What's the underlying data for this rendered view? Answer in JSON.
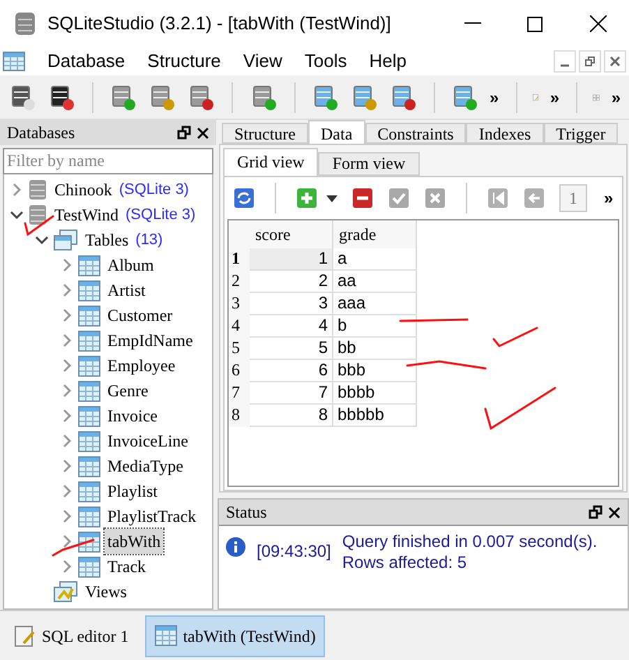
{
  "window": {
    "title": "SQLiteStudio (3.2.1) - [tabWith (TestWind)]"
  },
  "menu": [
    "Database",
    "Structure",
    "View",
    "Tools",
    "Help"
  ],
  "toolbar_overflow": [
    "»",
    "»",
    "»"
  ],
  "databases_panel": {
    "title": "Databases",
    "filter": {
      "placeholder": "Filter by name"
    },
    "tree": [
      {
        "label": "Chinook",
        "badge": "(SQLite 3)",
        "kind": "database",
        "expanded": false,
        "selected": false
      },
      {
        "label": "TestWind",
        "badge": "(SQLite 3)",
        "kind": "database",
        "expanded": true,
        "selected": false,
        "children": [
          {
            "label": "Tables",
            "badge": "(13)",
            "kind": "folder",
            "expanded": true,
            "selected": false,
            "children": [
              {
                "label": "Album",
                "kind": "table",
                "expanded": false,
                "selected": false
              },
              {
                "label": "Artist",
                "kind": "table",
                "expanded": false,
                "selected": false
              },
              {
                "label": "Customer",
                "kind": "table",
                "expanded": false,
                "selected": false
              },
              {
                "label": "EmpIdName",
                "kind": "table",
                "expanded": false,
                "selected": false
              },
              {
                "label": "Employee",
                "kind": "table",
                "expanded": false,
                "selected": false
              },
              {
                "label": "Genre",
                "kind": "table",
                "expanded": false,
                "selected": false
              },
              {
                "label": "Invoice",
                "kind": "table",
                "expanded": false,
                "selected": false
              },
              {
                "label": "InvoiceLine",
                "kind": "table",
                "expanded": false,
                "selected": false
              },
              {
                "label": "MediaType",
                "kind": "table",
                "expanded": false,
                "selected": false
              },
              {
                "label": "Playlist",
                "kind": "table",
                "expanded": false,
                "selected": false
              },
              {
                "label": "PlaylistTrack",
                "kind": "table",
                "expanded": false,
                "selected": false
              },
              {
                "label": "tabWith",
                "kind": "table",
                "expanded": false,
                "selected": true
              },
              {
                "label": "Track",
                "kind": "table",
                "expanded": false,
                "selected": false
              }
            ]
          },
          {
            "label": "Views",
            "kind": "views",
            "selected": false
          }
        ]
      }
    ]
  },
  "tabs": [
    {
      "label": "Structure",
      "selected": false
    },
    {
      "label": "Data",
      "selected": true
    },
    {
      "label": "Constraints",
      "selected": false
    },
    {
      "label": "Indexes",
      "selected": false
    },
    {
      "label": "Trigger",
      "selected": false
    }
  ],
  "subtabs": [
    {
      "label": "Grid view",
      "selected": true
    },
    {
      "label": "Form view",
      "selected": false
    }
  ],
  "page_field": {
    "value": "1"
  },
  "grid": {
    "columns": [
      "score",
      "grade"
    ],
    "rows": [
      {
        "number": "1",
        "score": "1",
        "grade": "a",
        "selected": true
      },
      {
        "number": "2",
        "score": "2",
        "grade": "aa",
        "selected": false
      },
      {
        "number": "3",
        "score": "3",
        "grade": "aaa",
        "selected": false
      },
      {
        "number": "4",
        "score": "4",
        "grade": "b",
        "selected": false
      },
      {
        "number": "5",
        "score": "5",
        "grade": "bb",
        "selected": false
      },
      {
        "number": "6",
        "score": "6",
        "grade": "bbb",
        "selected": false
      },
      {
        "number": "7",
        "score": "7",
        "grade": "bbbb",
        "selected": false
      },
      {
        "number": "8",
        "score": "8",
        "grade": "bbbbb",
        "selected": false
      }
    ]
  },
  "status": {
    "title": "Status",
    "time": "[09:43:30]",
    "message": [
      "Query finished in 0.007 second(s).",
      "Rows affected: 5"
    ]
  },
  "taskbar": [
    {
      "label": "SQL editor 1",
      "selected": false
    },
    {
      "label": "tabWith (TestWind)",
      "selected": true
    }
  ]
}
